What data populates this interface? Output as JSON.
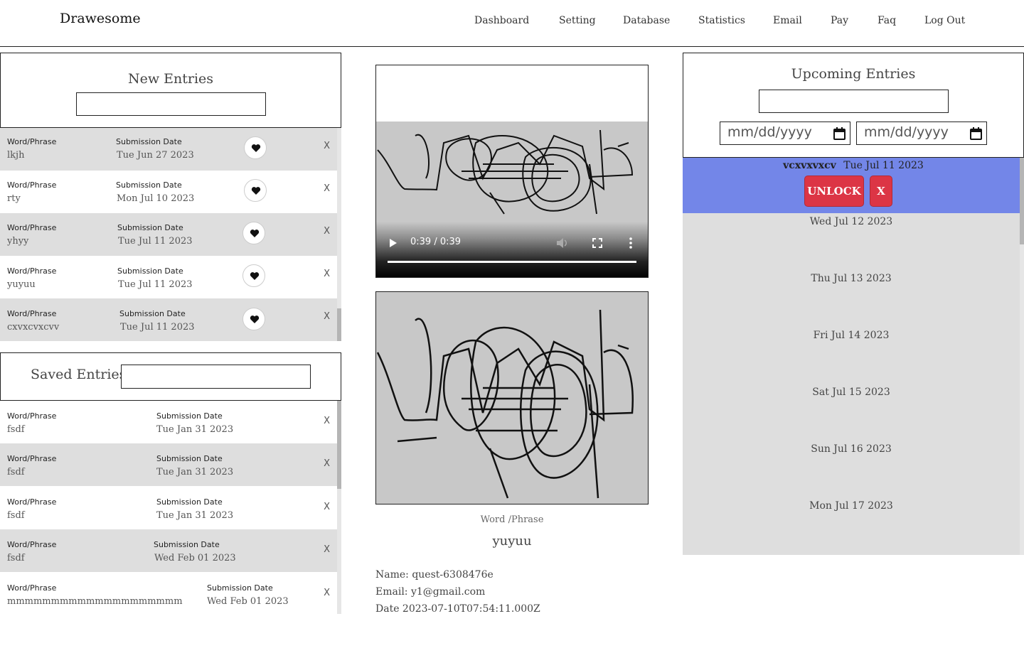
{
  "brand": "Drawesome",
  "nav": [
    "Dashboard",
    "Setting",
    "Database",
    "Statistics",
    "Email",
    "Pay",
    "Faq",
    "Log Out"
  ],
  "new_entries": {
    "title": "New Entries",
    "search_value": "",
    "rows": [
      {
        "word_label": "Word/Phrase",
        "word": "lkjh",
        "date_label": "Submission Date",
        "date": "Tue Jun 27 2023",
        "remove": "X"
      },
      {
        "word_label": "Word/Phrase",
        "word": "rty",
        "date_label": "Submission Date",
        "date": "Mon Jul 10 2023",
        "remove": "X"
      },
      {
        "word_label": "Word/Phrase",
        "word": "yhyy",
        "date_label": "Submission Date",
        "date": "Tue Jul 11 2023",
        "remove": "X"
      },
      {
        "word_label": "Word/Phrase",
        "word": "yuyuu",
        "date_label": "Submission Date",
        "date": "Tue Jul 11 2023",
        "remove": "X"
      },
      {
        "word_label": "Word/Phrase",
        "word": "cxvxcvxcvv",
        "date_label": "Submission Date",
        "date": "Tue Jul 11 2023",
        "remove": "X"
      }
    ]
  },
  "saved_entries": {
    "title": "Saved Entries",
    "search_value": "",
    "rows": [
      {
        "word_label": "Word/Phrase",
        "word": "fsdf",
        "date_label": "Submission Date",
        "date": "Tue Jan 31 2023",
        "remove": "X"
      },
      {
        "word_label": "Word/Phrase",
        "word": "fsdf",
        "date_label": "Submission Date",
        "date": "Tue Jan 31 2023",
        "remove": "X"
      },
      {
        "word_label": "Word/Phrase",
        "word": "fsdf",
        "date_label": "Submission Date",
        "date": "Tue Jan 31 2023",
        "remove": "X"
      },
      {
        "word_label": "Word/Phrase",
        "word": "fsdf",
        "date_label": "Submission Date",
        "date": "Wed Feb 01 2023",
        "remove": "X"
      },
      {
        "word_label": "Word/Phrase",
        "word": "mmmmmmmmmmmmmmmmmmmm",
        "date_label": "Submission Date",
        "date": "Wed Feb 01 2023",
        "remove": "X"
      }
    ]
  },
  "player": {
    "time": "0:39 / 0:39",
    "progress": 1.0
  },
  "detail": {
    "word_label": "Word /Phrase",
    "word": "yuyuu",
    "name": "Name: quest-6308476e",
    "email": "Email: y1@gmail.com",
    "date": "Date 2023-07-10T07:54:11.000Z"
  },
  "upcoming": {
    "title": "Upcoming Entries",
    "search_value": "",
    "date_from_placeholder": "mm/dd/yyyy",
    "date_to_placeholder": "mm/dd/yyyy",
    "selected": {
      "word": "vcxvxvxcv",
      "date": "Tue Jul 11 2023",
      "unlock_label": "UNLOCK",
      "remove_label": "X"
    },
    "dates": [
      "Wed Jul 12 2023",
      "Thu Jul 13 2023",
      "Fri Jul 14 2023",
      "Sat Jul 15 2023",
      "Sun Jul 16 2023",
      "Mon Jul 17 2023"
    ]
  },
  "colors": {
    "selected_row": "#7386e8",
    "danger": "#dc3545",
    "row_alt": "#dedede",
    "canvas_bg": "#c8c8c8"
  }
}
